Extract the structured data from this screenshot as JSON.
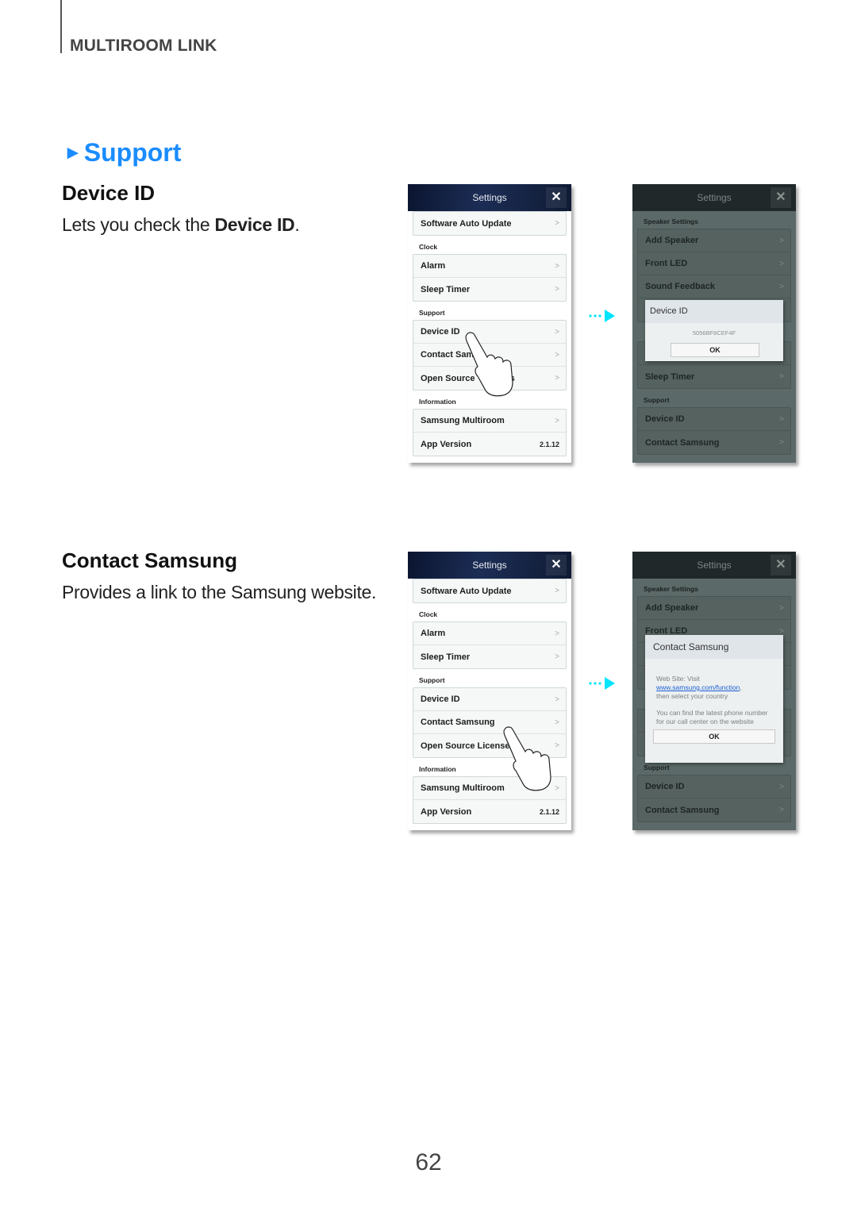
{
  "header": {
    "chapter": "MULTIROOM LINK"
  },
  "section": {
    "title": "Support",
    "marker_icon": "right-triangle-icon"
  },
  "device_id": {
    "heading": "Device ID",
    "desc_prefix": "Lets you check the ",
    "desc_bold": "Device ID",
    "desc_suffix": "."
  },
  "contact": {
    "heading": "Contact Samsung",
    "desc": "Provides a link to the Samsung website."
  },
  "settings_screen": {
    "title": "Settings",
    "close_icon": "close-icon",
    "software_auto_update": "Software Auto Update",
    "clock_label": "Clock",
    "alarm": "Alarm",
    "sleep_timer": "Sleep Timer",
    "support_label": "Support",
    "device_id": "Device ID",
    "contact_samsung": "Contact Samsung",
    "contact_samsung_partial": "Contact Sam",
    "open_source": "Open Source Licenses",
    "open_source_partial_a": "Open Source",
    "open_source_partial_b": "es",
    "open_source_partial_c": "Open Source License",
    "information_label": "Information",
    "samsung_multiroom": "Samsung Multiroom",
    "app_version": "App Version",
    "app_version_value": "2.1.12",
    "chevron": ">"
  },
  "speaker_screen": {
    "title": "Settings",
    "speaker_settings_label": "Speaker Settings",
    "add_speaker": "Add Speaker",
    "front_led": "Front LED",
    "sound_feedback": "Sound Feedback",
    "sleep_timer": "Sleep Timer",
    "support_label": "Support",
    "device_id": "Device ID",
    "contact_samsung": "Contact Samsung",
    "chevron": ">"
  },
  "device_id_dialog": {
    "title": "Device ID",
    "value": "5056BF8CEF4F",
    "ok": "OK"
  },
  "contact_dialog": {
    "title": "Contact Samsung",
    "line1": "Web Site: Visit",
    "link": "www.samsung.com/function",
    "link_suffix": ",",
    "line3": "then select your country",
    "para2": "You can find the latest phone number for our call center on the website",
    "ok": "OK"
  },
  "colors": {
    "accent": "#1a8cff",
    "arrow": "#00e5ff",
    "link": "#1a5fd6"
  },
  "page_number": "62"
}
